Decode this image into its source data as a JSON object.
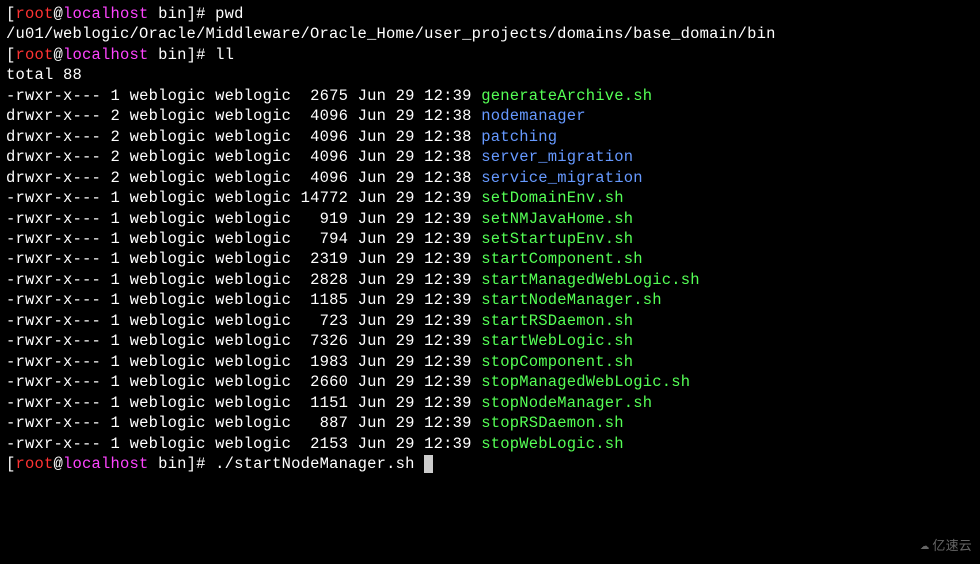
{
  "prompt": {
    "user": "root",
    "host": "localhost",
    "dir": "bin"
  },
  "commands": {
    "cmd1": "pwd",
    "cmd1_output": "/u01/weblogic/Oracle/Middleware/Oracle_Home/user_projects/domains/base_domain/bin",
    "cmd2": "ll",
    "cmd2_total": "total 88",
    "cmd3": "./startNodeManager.sh "
  },
  "listing": [
    {
      "perms": "-rwxr-x---",
      "links": "1",
      "owner": "weblogic",
      "group": "weblogic",
      "size": " 2675",
      "date": "Jun 29 12:39",
      "name": "generateArchive.sh",
      "type": "exec"
    },
    {
      "perms": "drwxr-x---",
      "links": "2",
      "owner": "weblogic",
      "group": "weblogic",
      "size": " 4096",
      "date": "Jun 29 12:38",
      "name": "nodemanager",
      "type": "dir"
    },
    {
      "perms": "drwxr-x---",
      "links": "2",
      "owner": "weblogic",
      "group": "weblogic",
      "size": " 4096",
      "date": "Jun 29 12:38",
      "name": "patching",
      "type": "dir"
    },
    {
      "perms": "drwxr-x---",
      "links": "2",
      "owner": "weblogic",
      "group": "weblogic",
      "size": " 4096",
      "date": "Jun 29 12:38",
      "name": "server_migration",
      "type": "dir"
    },
    {
      "perms": "drwxr-x---",
      "links": "2",
      "owner": "weblogic",
      "group": "weblogic",
      "size": " 4096",
      "date": "Jun 29 12:38",
      "name": "service_migration",
      "type": "dir"
    },
    {
      "perms": "-rwxr-x---",
      "links": "1",
      "owner": "weblogic",
      "group": "weblogic",
      "size": "14772",
      "date": "Jun 29 12:39",
      "name": "setDomainEnv.sh",
      "type": "exec"
    },
    {
      "perms": "-rwxr-x---",
      "links": "1",
      "owner": "weblogic",
      "group": "weblogic",
      "size": "  919",
      "date": "Jun 29 12:39",
      "name": "setNMJavaHome.sh",
      "type": "exec"
    },
    {
      "perms": "-rwxr-x---",
      "links": "1",
      "owner": "weblogic",
      "group": "weblogic",
      "size": "  794",
      "date": "Jun 29 12:39",
      "name": "setStartupEnv.sh",
      "type": "exec"
    },
    {
      "perms": "-rwxr-x---",
      "links": "1",
      "owner": "weblogic",
      "group": "weblogic",
      "size": " 2319",
      "date": "Jun 29 12:39",
      "name": "startComponent.sh",
      "type": "exec"
    },
    {
      "perms": "-rwxr-x---",
      "links": "1",
      "owner": "weblogic",
      "group": "weblogic",
      "size": " 2828",
      "date": "Jun 29 12:39",
      "name": "startManagedWebLogic.sh",
      "type": "exec"
    },
    {
      "perms": "-rwxr-x---",
      "links": "1",
      "owner": "weblogic",
      "group": "weblogic",
      "size": " 1185",
      "date": "Jun 29 12:39",
      "name": "startNodeManager.sh",
      "type": "exec"
    },
    {
      "perms": "-rwxr-x---",
      "links": "1",
      "owner": "weblogic",
      "group": "weblogic",
      "size": "  723",
      "date": "Jun 29 12:39",
      "name": "startRSDaemon.sh",
      "type": "exec"
    },
    {
      "perms": "-rwxr-x---",
      "links": "1",
      "owner": "weblogic",
      "group": "weblogic",
      "size": " 7326",
      "date": "Jun 29 12:39",
      "name": "startWebLogic.sh",
      "type": "exec"
    },
    {
      "perms": "-rwxr-x---",
      "links": "1",
      "owner": "weblogic",
      "group": "weblogic",
      "size": " 1983",
      "date": "Jun 29 12:39",
      "name": "stopComponent.sh",
      "type": "exec"
    },
    {
      "perms": "-rwxr-x---",
      "links": "1",
      "owner": "weblogic",
      "group": "weblogic",
      "size": " 2660",
      "date": "Jun 29 12:39",
      "name": "stopManagedWebLogic.sh",
      "type": "exec"
    },
    {
      "perms": "-rwxr-x---",
      "links": "1",
      "owner": "weblogic",
      "group": "weblogic",
      "size": " 1151",
      "date": "Jun 29 12:39",
      "name": "stopNodeManager.sh",
      "type": "exec"
    },
    {
      "perms": "-rwxr-x---",
      "links": "1",
      "owner": "weblogic",
      "group": "weblogic",
      "size": "  887",
      "date": "Jun 29 12:39",
      "name": "stopRSDaemon.sh",
      "type": "exec"
    },
    {
      "perms": "-rwxr-x---",
      "links": "1",
      "owner": "weblogic",
      "group": "weblogic",
      "size": " 2153",
      "date": "Jun 29 12:39",
      "name": "stopWebLogic.sh",
      "type": "exec"
    }
  ],
  "watermark": {
    "text": "亿速云"
  }
}
